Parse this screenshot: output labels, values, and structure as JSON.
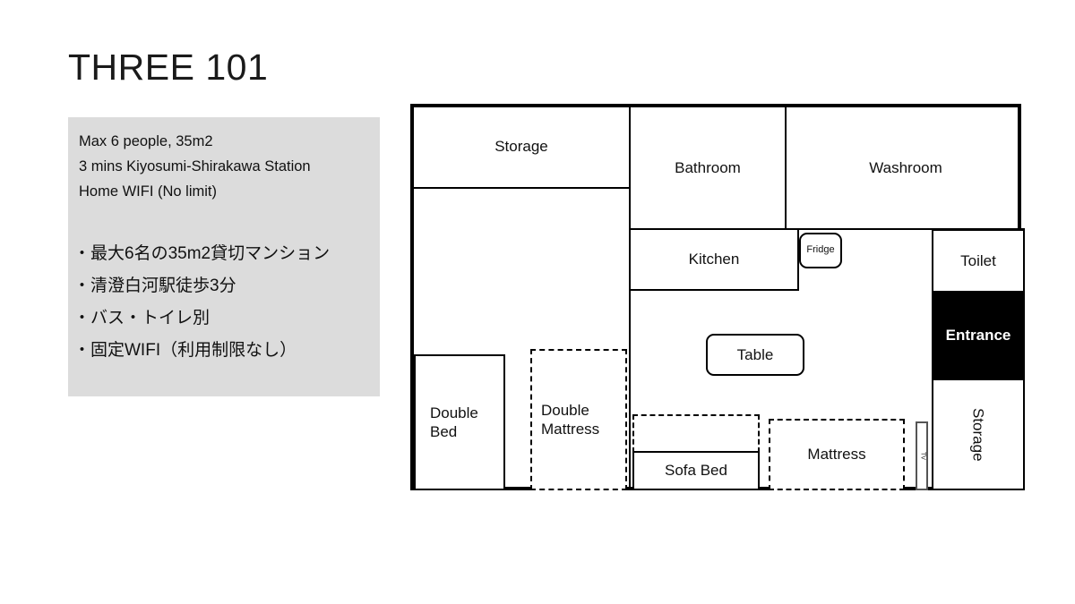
{
  "title": "THREE 101",
  "info": {
    "english_lines": [
      "Max 6 people, 35m2",
      "3 mins Kiyosumi-Shirakawa Station",
      "Home WIFI (No limit)"
    ],
    "japanese_lines": [
      "・最大6名の35m2貸切マンション",
      "・清澄白河駅徒歩3分",
      "・バス・トイレ別",
      "・固定WIFI（利用制限なし）"
    ],
    "background_color": "#dcdcdc"
  },
  "floorplan": {
    "rooms": {
      "storage_top": "Storage",
      "bathroom": "Bathroom",
      "washroom": "Washroom",
      "kitchen": "Kitchen",
      "fridge": "Fridge",
      "toilet": "Toilet",
      "entrance": "Entrance",
      "storage_right": "Storage",
      "table": "Table",
      "double_bed": "Double\nBed",
      "double_bed_line1": "Double",
      "double_bed_line2": "Bed",
      "double_mattress_line1": "Double",
      "double_mattress_line2": "Mattress",
      "sofa_bed": "Sofa Bed",
      "mattress": "Mattress",
      "tv": "TV"
    },
    "colors": {
      "wall": "#000000",
      "entrance_fill": "#000000",
      "entrance_text": "#ffffff",
      "room_fill": "#ffffff"
    }
  }
}
